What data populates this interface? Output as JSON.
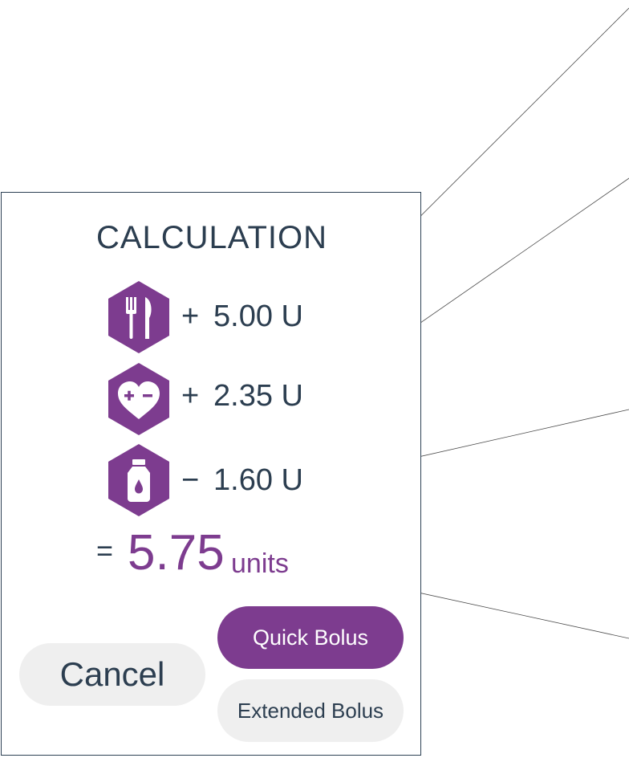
{
  "calculation": {
    "title": "CALCULATION",
    "rows": [
      {
        "icon": "carbs-fork-knife-icon",
        "op": "+",
        "value": "5.00 U"
      },
      {
        "icon": "correction-heart-icon",
        "op": "+",
        "value": "2.35 U"
      },
      {
        "icon": "insulin-on-board-bottle-icon",
        "op": "−",
        "value": "1.60 U"
      }
    ],
    "equals": "=",
    "total": "5.75",
    "units": "units"
  },
  "buttons": {
    "cancel": "Cancel",
    "quick_bolus": "Quick Bolus",
    "extended_bolus": "Extended Bolus"
  },
  "colors": {
    "accent": "#7d3c8f",
    "text": "#2c3e50",
    "button_gray": "#efefef",
    "border": "#2d4154"
  }
}
